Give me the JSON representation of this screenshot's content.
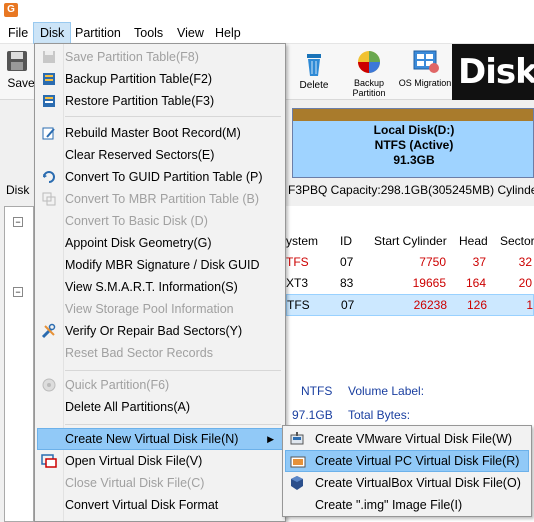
{
  "menubar": {
    "items": [
      "File",
      "Disk",
      "Partition",
      "Tools",
      "View",
      "Help"
    ]
  },
  "toolbar": {
    "save_label": "Save",
    "delete_label": "Delete",
    "backup_partition_label_1": "Backup",
    "backup_partition_label_2": "Partition",
    "os_migration_label": "OS Migration",
    "brand_text": "DiskG"
  },
  "diskmap": {
    "partition_name": "Local Disk(D:)",
    "partition_fs": "NTFS (Active)",
    "partition_size": "91.3GB",
    "left_label": "Disk",
    "disk_info": "F3PBQ  Capacity:298.1GB(305245MB)  Cylinders"
  },
  "table": {
    "headers": [
      "ystem",
      "ID",
      "Start Cylinder",
      "Head",
      "Sector"
    ],
    "rows": [
      {
        "fs": "TFS",
        "id": "07",
        "start": "7750",
        "head": "37",
        "sector": "32",
        "fs_color": "#cc0000"
      },
      {
        "fs": "XT3",
        "id": "83",
        "start": "19665",
        "head": "164",
        "sector": "20",
        "fs_color": "#000000"
      },
      {
        "fs": "TFS",
        "id": "07",
        "start": "26238",
        "head": "126",
        "sector": "1",
        "fs_color": "#000000"
      }
    ]
  },
  "info": {
    "fs_value": "NTFS",
    "volume_label": "Volume Label:",
    "size_value": "97.1GB",
    "total_bytes": "Total Bytes:"
  },
  "disk_menu": {
    "items": [
      {
        "label": "Save Partition Table(F8)",
        "disabled": true,
        "icon": "save-icon"
      },
      {
        "label": "Backup Partition Table(F2)",
        "disabled": false,
        "icon": "backup-table-icon"
      },
      {
        "label": "Restore Partition Table(F3)",
        "disabled": false,
        "icon": "restore-table-icon"
      },
      {
        "label": "Rebuild Master Boot Record(M)",
        "disabled": false,
        "icon": "rebuild-mbr-icon"
      },
      {
        "label": "Clear Reserved Sectors(E)",
        "disabled": false,
        "icon": ""
      },
      {
        "label": "Convert To GUID Partition Table (P)",
        "disabled": false,
        "icon": "convert-guid-icon"
      },
      {
        "label": "Convert To MBR Partition Table (B)",
        "disabled": true,
        "icon": "convert-mbr-icon"
      },
      {
        "label": "Convert To Basic Disk (D)",
        "disabled": true,
        "icon": ""
      },
      {
        "label": "Appoint Disk Geometry(G)",
        "disabled": false,
        "icon": ""
      },
      {
        "label": "Modify MBR Signature / Disk GUID",
        "disabled": false,
        "icon": ""
      },
      {
        "label": "View S.M.A.R.T. Information(S)",
        "disabled": false,
        "icon": ""
      },
      {
        "label": "View Storage Pool Information",
        "disabled": true,
        "icon": ""
      },
      {
        "label": "Verify Or Repair Bad Sectors(Y)",
        "disabled": false,
        "icon": "tools-icon"
      },
      {
        "label": "Reset Bad Sector Records",
        "disabled": true,
        "icon": ""
      },
      {
        "label": "Quick Partition(F6)",
        "disabled": true,
        "icon": "quick-partition-icon"
      },
      {
        "label": "Delete All Partitions(A)",
        "disabled": false,
        "icon": ""
      },
      {
        "label": "Create New Virtual Disk File(N)",
        "disabled": false,
        "icon": "",
        "submenu": true
      },
      {
        "label": "Open Virtual Disk File(V)",
        "disabled": false,
        "icon": "open-virtual-disk-icon"
      },
      {
        "label": "Close Virtual Disk File(C)",
        "disabled": true,
        "icon": ""
      },
      {
        "label": "Convert Virtual Disk Format",
        "disabled": false,
        "icon": ""
      }
    ]
  },
  "submenu": {
    "items": [
      {
        "label": "Create VMware Virtual Disk File(W)",
        "icon": "vmware-icon"
      },
      {
        "label": "Create Virtual PC Virtual Disk File(R)",
        "icon": "virtual-pc-icon"
      },
      {
        "label": "Create VirtualBox Virtual Disk File(O)",
        "icon": "virtualbox-icon"
      },
      {
        "label": "Create \".img\" Image File(I)",
        "icon": ""
      }
    ]
  }
}
